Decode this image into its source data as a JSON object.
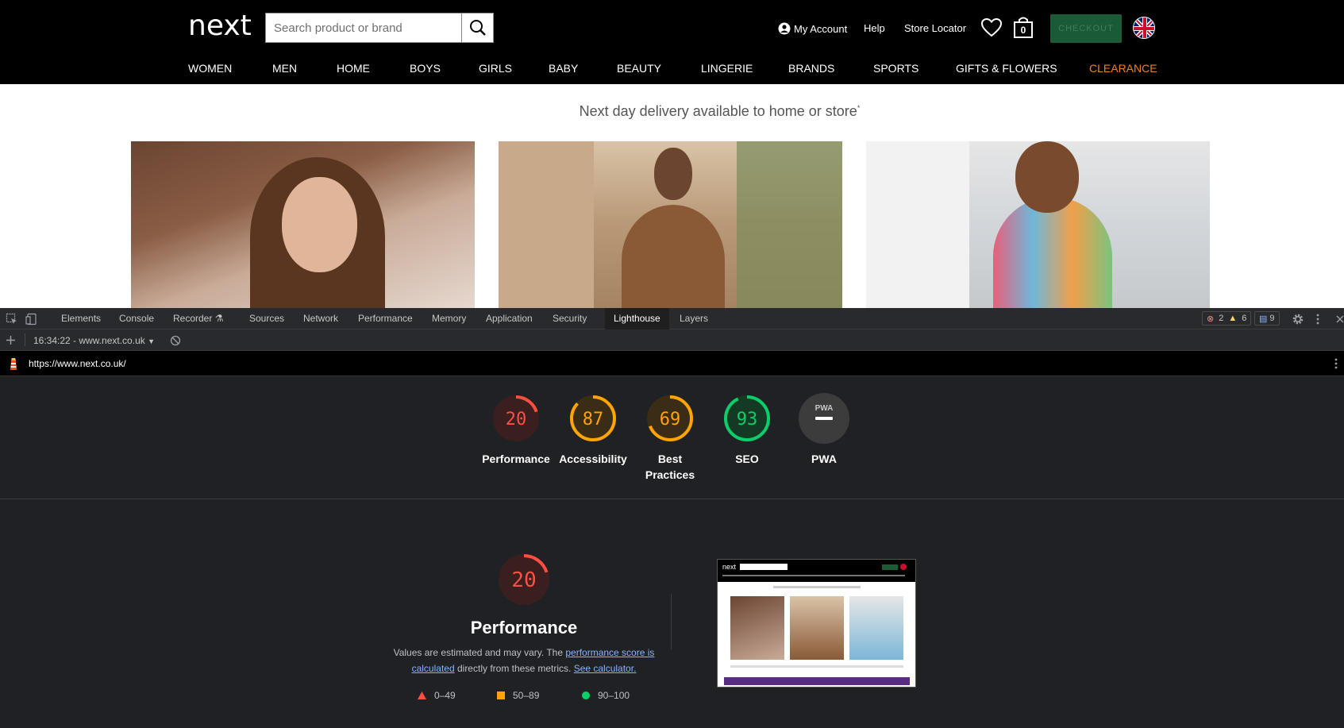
{
  "site": {
    "logo": "next",
    "search_placeholder": "Search product or brand",
    "my_account": "My Account",
    "help": "Help",
    "store_locator": "Store Locator",
    "bag_count": "0",
    "checkout": "CHECKOUT",
    "nav": [
      "WOMEN",
      "MEN",
      "HOME",
      "BOYS",
      "GIRLS",
      "BABY",
      "BEAUTY",
      "LINGERIE",
      "BRANDS",
      "SPORTS",
      "GIFTS & FLOWERS",
      "CLEARANCE"
    ],
    "delivery_banner": "Next day delivery available to home or store",
    "delivery_mark": "*",
    "accent_color": "#f0821e"
  },
  "devtools": {
    "tabs": [
      "Elements",
      "Console",
      "Recorder",
      "Sources",
      "Network",
      "Performance",
      "Memory",
      "Application",
      "Security",
      "Lighthouse",
      "Layers"
    ],
    "active_tab": "Lighthouse",
    "errors": "2",
    "warnings": "6",
    "messages": "9",
    "report_select": "16:34:22 - www.next.co.uk",
    "url": "https://www.next.co.uk/"
  },
  "scores": [
    {
      "label": "Performance",
      "score": 20,
      "color": "#ff4e42"
    },
    {
      "label": "Accessibility",
      "score": 87,
      "color": "#ffa400"
    },
    {
      "label": "Best Practices",
      "score": 69,
      "color": "#ffa400"
    },
    {
      "label": "SEO",
      "score": 93,
      "color": "#0cce6b"
    },
    {
      "label": "PWA",
      "score": null,
      "badge": "PWA",
      "color": "#9aa0a6"
    }
  ],
  "performance": {
    "score": 20,
    "title": "Performance",
    "desc_before": "Values are estimated and may vary. The ",
    "link1": "performance score is calculated",
    "desc_mid": " directly from these metrics. ",
    "link2": "See calculator.",
    "legend": [
      {
        "range": "0–49",
        "color": "#ff4e42",
        "shape": "triangle"
      },
      {
        "range": "50–89",
        "color": "#ffa400",
        "shape": "square"
      },
      {
        "range": "90–100",
        "color": "#0cce6b",
        "shape": "circle"
      }
    ]
  }
}
